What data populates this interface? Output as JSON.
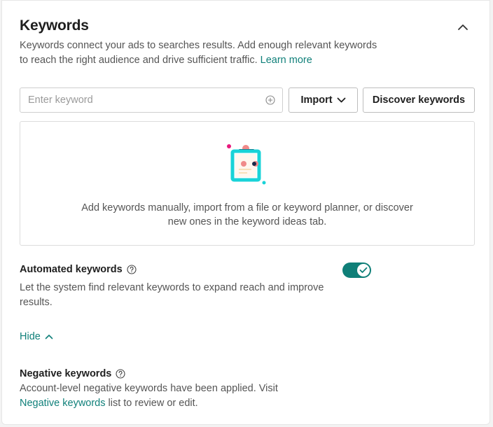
{
  "section": {
    "title": "Keywords",
    "description": "Keywords connect your ads to searches results. Add enough relevant keywords to reach the right audience and drive sufficient traffic.",
    "learn_more": "Learn more",
    "collapse_icon": "chevron-up-icon"
  },
  "input": {
    "placeholder": "Enter keyword",
    "value": "",
    "add_icon": "plus-circle-icon"
  },
  "buttons": {
    "import_label": "Import",
    "import_icon": "chevron-down-icon",
    "discover_label": "Discover keywords"
  },
  "empty_state": {
    "text": "Add keywords manually, import from a file or keyword planner, or discover new ones in the keyword ideas tab.",
    "illustration": "clipboard-illustration"
  },
  "automated": {
    "title": "Automated keywords",
    "description": "Let the system find relevant keywords to expand reach and improve results.",
    "toggle_on": true,
    "toggle_color": "#0f7f78"
  },
  "hide": {
    "label": "Hide",
    "icon": "chevron-up-icon"
  },
  "negative": {
    "title": "Negative keywords",
    "description_prefix": "Account-level negative keywords have been applied. Visit",
    "link": "Negative keywords",
    "description_suffix": "list to review or edit."
  },
  "colors": {
    "accent": "#10807a",
    "illustration_cyan": "#19d3d8",
    "illustration_pink": "#f08a8a",
    "illustration_navy": "#1c2a4a",
    "illustration_magenta": "#e8197d"
  }
}
